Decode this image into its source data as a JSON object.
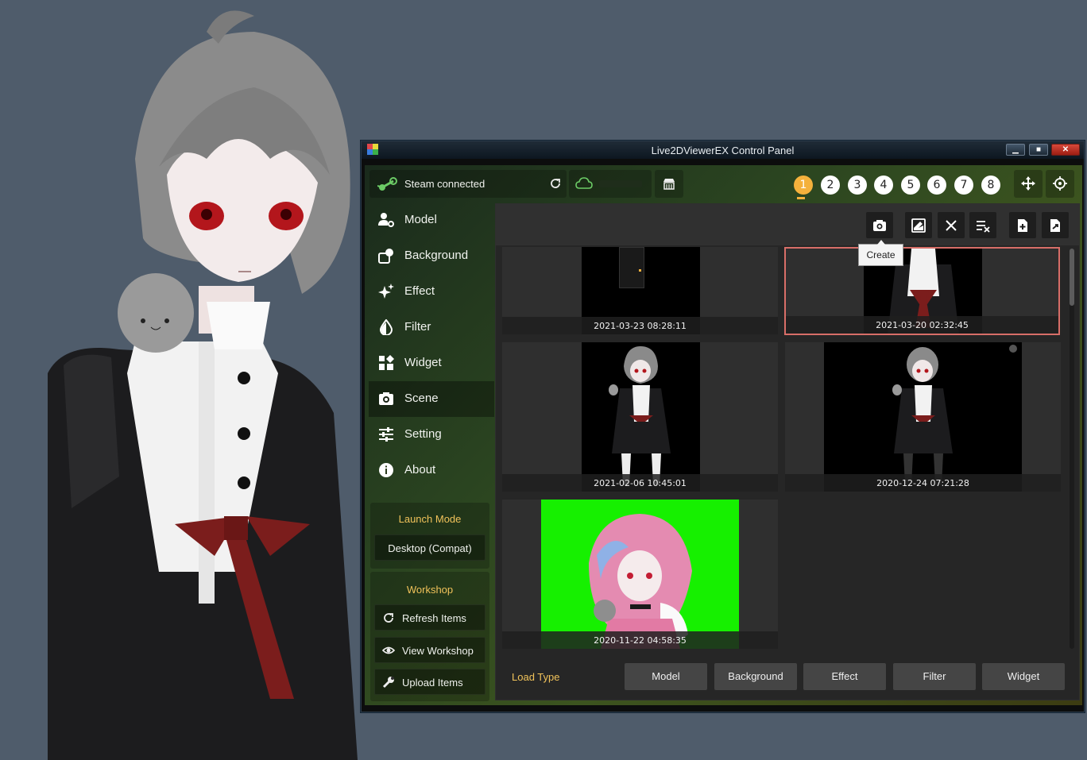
{
  "window": {
    "title": "Live2DViewerEX Control Panel",
    "min": "▁",
    "max": "■",
    "close": "✕"
  },
  "status": {
    "steam_text": "Steam connected"
  },
  "slots": [
    "1",
    "2",
    "3",
    "4",
    "5",
    "6",
    "7",
    "8"
  ],
  "active_slot": "1",
  "nav": {
    "items": [
      {
        "label": "Model",
        "icon": "model-settings-icon"
      },
      {
        "label": "Background",
        "icon": "background-icon"
      },
      {
        "label": "Effect",
        "icon": "sparkle-icon"
      },
      {
        "label": "Filter",
        "icon": "drop-icon"
      },
      {
        "label": "Widget",
        "icon": "widget-icon"
      },
      {
        "label": "Scene",
        "icon": "camera-icon"
      },
      {
        "label": "Setting",
        "icon": "sliders-icon"
      },
      {
        "label": "About",
        "icon": "info-icon"
      }
    ],
    "active": "Scene"
  },
  "launch_mode": {
    "title": "Launch Mode",
    "value": "Desktop (Compat)"
  },
  "workshop": {
    "title": "Workshop",
    "refresh": "Refresh Items",
    "view": "View Workshop",
    "upload": "Upload Items"
  },
  "toolbar": {
    "tooltip": "Create",
    "icons": [
      "camera-icon",
      "edit-image-icon",
      "close-icon",
      "clear-list-icon",
      "add-file-icon",
      "export-file-icon"
    ]
  },
  "scenes": [
    {
      "timestamp": "2021-03-23 08:28:11"
    },
    {
      "timestamp": "2021-03-20 02:32:45"
    },
    {
      "timestamp": "2021-02-06 10:45:01"
    },
    {
      "timestamp": "2020-12-24 07:21:28"
    },
    {
      "timestamp": "2020-11-22 04:58:35"
    }
  ],
  "load_type": {
    "label": "Load Type",
    "buttons": [
      "Model",
      "Background",
      "Effect",
      "Filter",
      "Widget"
    ]
  },
  "colors": {
    "accent": "#f0c25a",
    "slot_active": "#f4b13c",
    "selected_border": "#d86e68",
    "green_screen": "#16f000"
  }
}
